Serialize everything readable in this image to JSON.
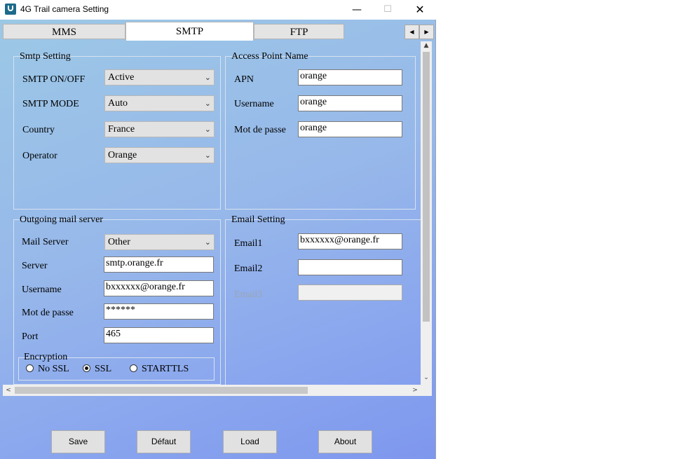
{
  "window": {
    "title": "4G Trail camera Setting",
    "minimize": "—",
    "maximize": "☐",
    "close": "✕"
  },
  "tabs": [
    {
      "label": "MMS"
    },
    {
      "label": "SMTP"
    },
    {
      "label": "FTP"
    }
  ],
  "tab_scroll": {
    "left": "◀",
    "right": "▶"
  },
  "smtp_setting": {
    "title": "Smtp Setting",
    "rows": [
      {
        "label": "SMTP ON/OFF",
        "value": "Active"
      },
      {
        "label": "SMTP MODE",
        "value": "Auto"
      },
      {
        "label": "Country",
        "value": "France"
      },
      {
        "label": "Operator",
        "value": "Orange"
      }
    ]
  },
  "apn": {
    "title": "Access Point Name",
    "rows": [
      {
        "label": "APN",
        "value": "orange"
      },
      {
        "label": "Username",
        "value": "orange"
      },
      {
        "label": "Mot de passe",
        "value": "orange"
      }
    ]
  },
  "outgoing": {
    "title": "Outgoing mail server",
    "mail_server_label": "Mail Server",
    "mail_server_value": "Other",
    "server_label": "Server",
    "server_value": "smtp.orange.fr",
    "username_label": "Username",
    "username_value": "bxxxxxx@orange.fr",
    "password_label": "Mot de passe",
    "password_value": "******",
    "port_label": "Port",
    "port_value": "465",
    "encryption": {
      "title": "Encryption",
      "options": [
        {
          "label": "No SSL",
          "selected": false
        },
        {
          "label": "SSL",
          "selected": true
        },
        {
          "label": "STARTTLS",
          "selected": false
        }
      ]
    }
  },
  "email_setting": {
    "title": "Email Setting",
    "email1_label": "Email1",
    "email1_value": "bxxxxxx@orange.fr",
    "email2_label": "Email2",
    "email2_value": "",
    "email3_label": "Email3",
    "email3_value": ""
  },
  "buttons": {
    "save": "Save",
    "default": "Défaut",
    "load": "Load",
    "about": "About"
  },
  "icons": {
    "dropdown": "chevron-down-icon",
    "app": "app-icon"
  }
}
